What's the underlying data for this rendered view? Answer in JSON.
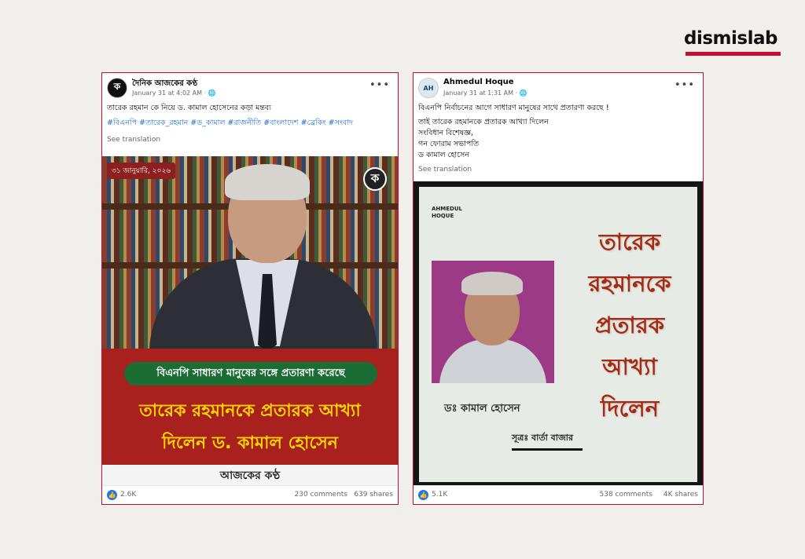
{
  "brand": {
    "name": "dismislab",
    "accent": "#c8102e"
  },
  "post1": {
    "page_name": "দৈনিক আজকের কণ্ঠ",
    "meta": "January 31 at 4:02 AM · 🌐",
    "avatar_letter": "ক",
    "caption": "তারেক রহমান কে নিয়ে ড. কামাল হোসেনের  কড়া মন্তব্য",
    "hashtags": "#বিএনপি #তারেক_রহমান #ড_কামাল #রাজনীতি #বাংলাদেশ #ব্রেকিং #সংবাদ",
    "see_translation": "See translation",
    "image": {
      "date_badge": "৩১ জানুয়ারি, ২০২৬",
      "logo_letter": "ক",
      "green_headline": "বিএনপি সাধারণ মানুষের সঙ্গে প্রতারণা করেছে",
      "yellow_line1": "তারেক রহমানকে প্রতারক আখ্যা",
      "yellow_line2": "দিলেন ড. কামাল হোসেন",
      "footer_brand": "আজকের কণ্ঠ"
    },
    "likes": "2.6K",
    "comments": "230 comments",
    "shares": "639 shares"
  },
  "post2": {
    "page_name": "Ahmedul Hoque",
    "meta": "January 31 at 1:31 AM · 🌐",
    "avatar_letter": "AH",
    "caption_lines": [
      "বিএনপি নির্বাচনের আগে সাধারণ মানুষের সাথে প্রতারণা করছে !",
      "তাই তারেক রহমানকে প্রতারক আখ্যা দিলেন",
      "সংবিধান বিশেষজ্ঞ,",
      "গন ফোরাম সভাপতি",
      "ড কামাল হোসেন"
    ],
    "see_translation": "See translation",
    "image": {
      "logo_line1": "AHMEDUL",
      "logo_line2": "HOQUE",
      "big_lines": [
        "তারেক",
        "রহমানকে",
        "প্রতারক",
        "আখ্যা",
        "দিলেন"
      ],
      "name_caption": "ডঃ কামাল হোসেন",
      "source": "সূত্রঃ বার্তা বাজার"
    },
    "likes": "5.1K",
    "comments": "538 comments",
    "shares": "4K shares"
  }
}
